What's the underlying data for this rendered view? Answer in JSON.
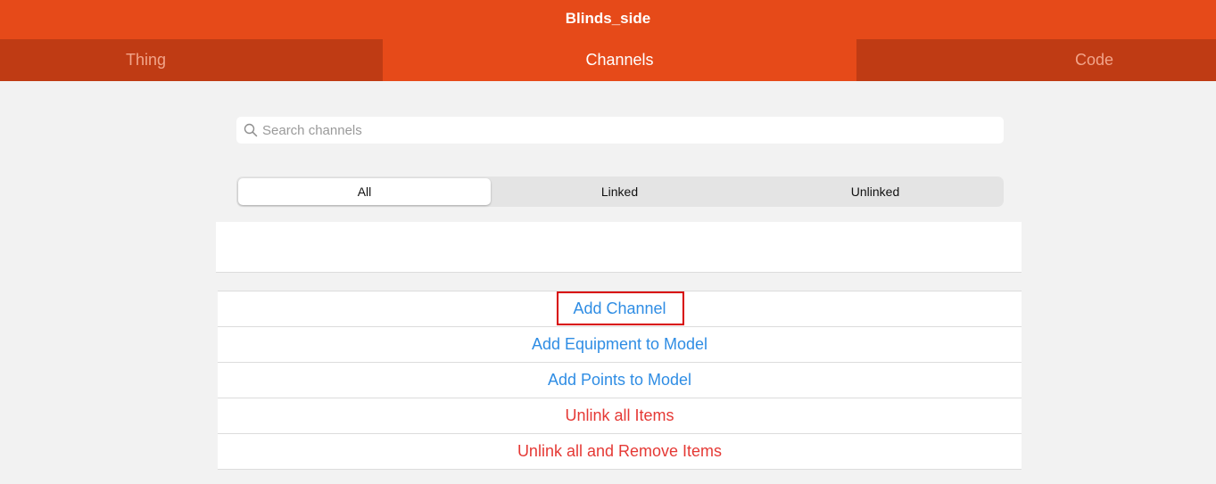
{
  "navbar": {
    "title": "Blinds_side"
  },
  "tabs": [
    {
      "label": "Thing",
      "active": false
    },
    {
      "label": "Channels",
      "active": true
    },
    {
      "label": "Code",
      "active": false
    }
  ],
  "search": {
    "placeholder": "Search channels",
    "value": ""
  },
  "filter": {
    "options": [
      "All",
      "Linked",
      "Unlinked"
    ],
    "selected": "All"
  },
  "actions": [
    {
      "label": "Add Channel",
      "color": "#2f8de4",
      "highlighted": true
    },
    {
      "label": "Add Equipment to Model",
      "color": "#2f8de4"
    },
    {
      "label": "Add Points to Model",
      "color": "#2f8de4"
    },
    {
      "label": "Unlink all Items",
      "color": "#e53935"
    },
    {
      "label": "Unlink all and Remove Items",
      "color": "#e53935"
    }
  ],
  "colors": {
    "brand": "#e64a19",
    "tab_inactive_bg": "#bf3b14",
    "highlight_box": "#d80000"
  }
}
